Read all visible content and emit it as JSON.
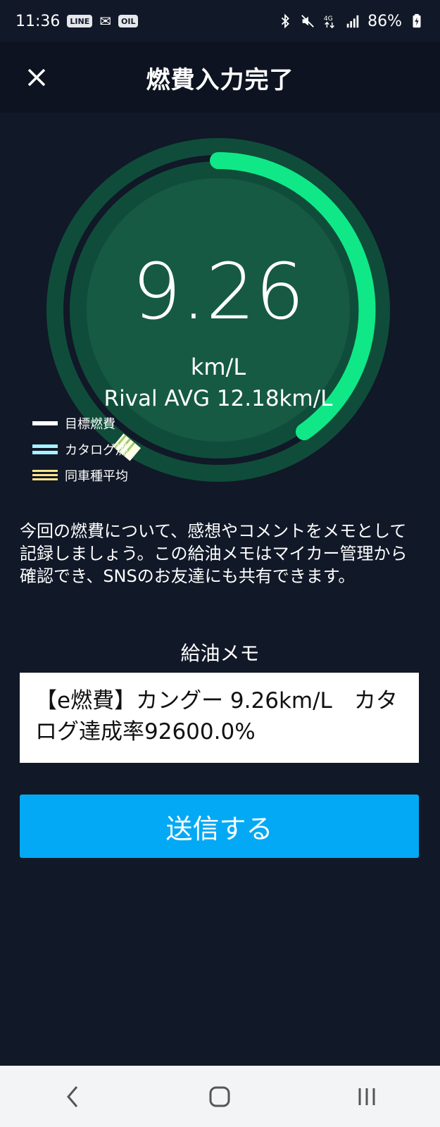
{
  "status_bar": {
    "time": "11:36",
    "left_icons": [
      "LINE",
      "✉",
      "OIL"
    ],
    "battery": "86%"
  },
  "header": {
    "title": "燃費入力完了"
  },
  "gauge": {
    "value": "9.26",
    "unit": "km/L",
    "rival": "Rival AVG 12.18km/L",
    "colors": {
      "ring_track": "#0f4d3a",
      "inner": "#165a44",
      "progress": "#10e887"
    }
  },
  "legend": [
    {
      "label": "目標燃費",
      "style": "white"
    },
    {
      "label": "カタログ燃",
      "style": "cyan"
    },
    {
      "label": "同車種平均",
      "style": "yellow"
    }
  ],
  "description": "今回の燃費について、感想やコメントをメモとして記録しましょう。この給油メモはマイカー管理から確認でき、SNSのお友達にも共有できます。",
  "memo": {
    "label": "給油メモ",
    "value": "【e燃費】カングー 9.26km/L　カタログ達成率92600.0%"
  },
  "send_button": "送信する"
}
